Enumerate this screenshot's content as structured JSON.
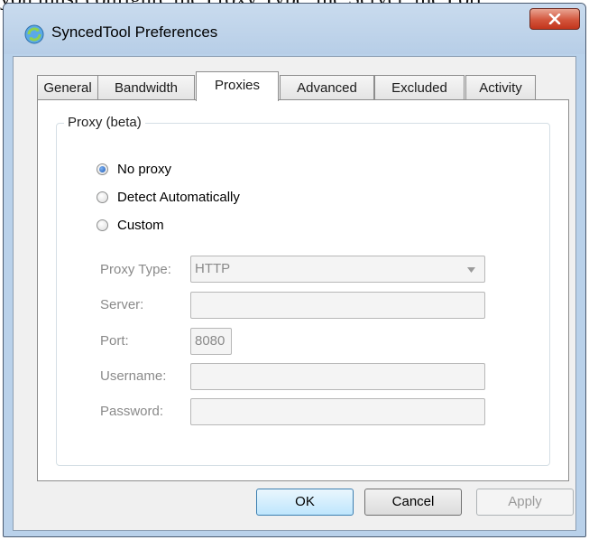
{
  "background_text": "you must configure the Proxy Type, the Server, the Port",
  "window": {
    "title": "SyncedTool Preferences",
    "app_icon": "synced-tool-icon",
    "close_icon": "close-icon"
  },
  "tabs": [
    {
      "label": "General",
      "active": false
    },
    {
      "label": "Bandwidth",
      "active": false
    },
    {
      "label": "Proxies",
      "active": true
    },
    {
      "label": "Advanced",
      "active": false
    },
    {
      "label": "Excluded",
      "active": false
    },
    {
      "label": "Activity",
      "active": false
    }
  ],
  "proxy_group": {
    "legend": "Proxy (beta)",
    "options": [
      {
        "label": "No proxy",
        "selected": true
      },
      {
        "label": "Detect Automatically",
        "selected": false
      },
      {
        "label": "Custom",
        "selected": false
      }
    ],
    "fields": {
      "proxy_type": {
        "label": "Proxy Type:",
        "value": "HTTP"
      },
      "server": {
        "label": "Server:",
        "value": ""
      },
      "port": {
        "label": "Port:",
        "value": "8080"
      },
      "username": {
        "label": "Username:",
        "value": ""
      },
      "password": {
        "label": "Password:",
        "value": ""
      }
    }
  },
  "buttons": {
    "ok": "OK",
    "cancel": "Cancel",
    "apply": "Apply"
  },
  "colors": {
    "frame": "#b9d1ea",
    "close_button": "#c2351c",
    "default_button_border": "#3c7fb1",
    "disabled_text": "#8a8a8a"
  }
}
